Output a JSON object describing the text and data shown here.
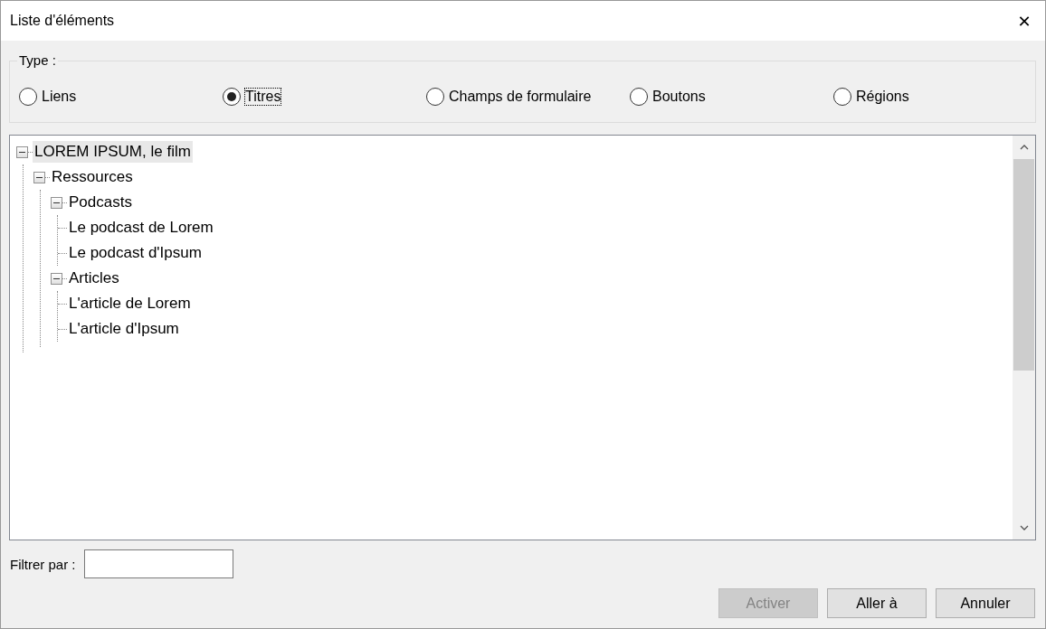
{
  "window": {
    "title": "Liste d'éléments",
    "close": "✕"
  },
  "type_group": {
    "label": "Type :",
    "options": [
      {
        "label": "Liens",
        "selected": false
      },
      {
        "label": "Titres",
        "selected": true
      },
      {
        "label": "Champs de formulaire",
        "selected": false
      },
      {
        "label": "Boutons",
        "selected": false
      },
      {
        "label": "Régions",
        "selected": false
      }
    ]
  },
  "tree": [
    {
      "label": "LOREM IPSUM, le film",
      "expanded": true,
      "selected": true,
      "children": [
        {
          "label": "Ressources",
          "expanded": true,
          "selected": false,
          "children": [
            {
              "label": "Podcasts",
              "expanded": true,
              "selected": false,
              "children": [
                {
                  "label": "Le podcast de Lorem",
                  "selected": false
                },
                {
                  "label": "Le podcast d'Ipsum",
                  "selected": false
                }
              ]
            },
            {
              "label": "Articles",
              "expanded": true,
              "selected": false,
              "children": [
                {
                  "label": "L'article de Lorem",
                  "selected": false
                },
                {
                  "label": "L'article d'Ipsum",
                  "selected": false
                }
              ]
            }
          ]
        }
      ]
    }
  ],
  "filter": {
    "label": "Filtrer par :"
  },
  "buttons": [
    {
      "label": "Activer",
      "disabled": true
    },
    {
      "label": "Aller à",
      "disabled": false
    },
    {
      "label": "Annuler",
      "disabled": false
    }
  ]
}
